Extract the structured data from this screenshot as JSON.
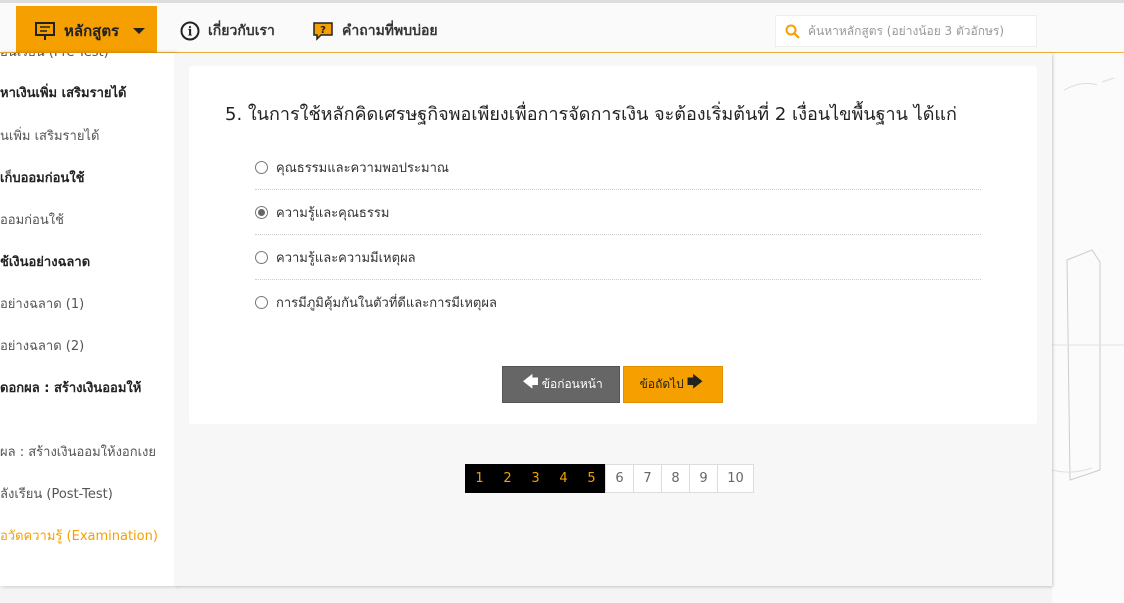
{
  "nav": {
    "courses_label": "หลักสูตร",
    "about_label": "เกี่ยวกับเรา",
    "faq_label": "คำถามที่พบบ่อย",
    "search_placeholder": "ค้นหาหลักสูตร (อย่างน้อย 3 ตัวอักษร)"
  },
  "sidebar": {
    "items": [
      {
        "label": "อนเรียน (Pre-Test)"
      },
      {
        "label": "หาเงินเพิ่ม เสริมรายได้"
      },
      {
        "label": "นเพิ่ม เสริมรายได้"
      },
      {
        "label": "เก็บออมก่อนใช้"
      },
      {
        "label": "ออมก่อนใช้"
      },
      {
        "label": "ช้เงินอย่างฉลาด"
      },
      {
        "label": "อย่างฉลาด (1)"
      },
      {
        "label": "อย่างฉลาด (2)"
      },
      {
        "label": "ดอกผล : สร้างเงินออมให้"
      },
      {
        "label": "ผล : สร้างเงินออมให้งอกเงย"
      },
      {
        "label": "ลังเรียน (Post-Test)"
      },
      {
        "label": "ื่อวัดความรู้ (Examination)"
      }
    ]
  },
  "quiz": {
    "question": "5. ในการใช้หลักคิดเศรษฐกิจพอเพียงเพื่อการจัดการเงิน จะต้องเริ่มต้นที่ 2 เงื่อนไขพื้นฐาน ได้แก่",
    "options": [
      {
        "label": "คุณธรรมและความพอประมาณ",
        "checked": false
      },
      {
        "label": "ความรู้และคุณธรรม",
        "checked": true
      },
      {
        "label": "ความรู้และความมีเหตุผล",
        "checked": false
      },
      {
        "label": "การมีภูมิคุ้มกันในตัวที่ดีและการมีเหตุผล",
        "checked": false
      }
    ],
    "prev_label": "ข้อก่อนหน้า",
    "next_label": "ข้อถัดไป"
  },
  "pagination": {
    "pages": [
      "1",
      "2",
      "3",
      "4",
      "5",
      "6",
      "7",
      "8",
      "9",
      "10"
    ],
    "answered_count": 5
  },
  "colors": {
    "accent": "#f5a000",
    "dark_button": "#666666"
  }
}
